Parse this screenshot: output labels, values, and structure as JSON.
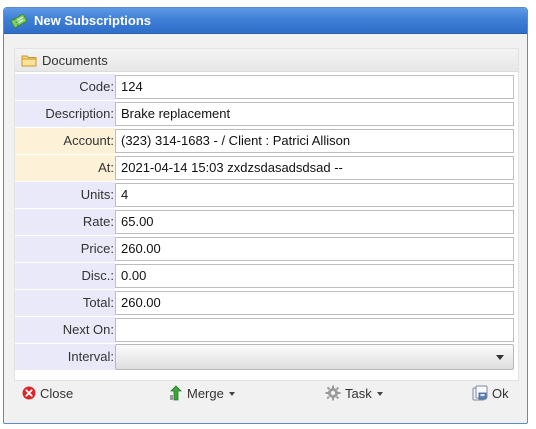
{
  "window": {
    "title": "New Subscriptions"
  },
  "section": {
    "title": "Documents"
  },
  "form": {
    "code": {
      "label": "Code:",
      "value": "124"
    },
    "description": {
      "label": "Description:",
      "value": "Brake replacement"
    },
    "account": {
      "label": "Account:",
      "value": "(323) 314-1683 -  / Client : Patrici Allison"
    },
    "at": {
      "label": "At:",
      "value": "2021-04-14 15:03 zxdzsdasadsdsad --"
    },
    "units": {
      "label": "Units:",
      "value": "4"
    },
    "rate": {
      "label": "Rate:",
      "value": "65.00"
    },
    "price": {
      "label": "Price:",
      "value": "260.00"
    },
    "disc": {
      "label": "Disc.:",
      "value": "0.00"
    },
    "total": {
      "label": "Total:",
      "value": "260.00"
    },
    "next_on": {
      "label": "Next On:",
      "value": ""
    },
    "interval": {
      "label": "Interval:",
      "value": ""
    }
  },
  "toolbar": {
    "close": "Close",
    "merge": "Merge",
    "task": "Task",
    "ok": "Ok"
  },
  "colors": {
    "titlebar": "#3f7fd6",
    "label_bg": "#e9e9f9",
    "label_warm_bg": "#fdf1d7",
    "close_icon": "#d9262c",
    "merge_icon": "#3aa53a"
  },
  "icons": [
    "ticket-icon",
    "folder-icon",
    "close-icon",
    "merge-icon",
    "gear-icon",
    "save-icon"
  ]
}
